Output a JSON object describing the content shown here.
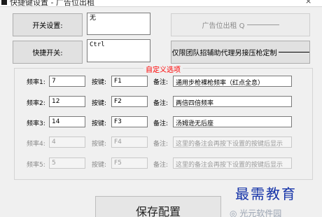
{
  "window": {
    "title": "快捷键设置 - 广告位出租",
    "close_symbol": "×"
  },
  "top": {
    "switch_button": "开关设置:",
    "switch_value": "无",
    "hotkey_button": "快捷开关:",
    "hotkey_value": "Ctrl",
    "ad_button": "广告位出租 Q",
    "custom_button": "仅限团队招辅助代理另接压枪定制"
  },
  "group_title": "自定义选项",
  "rows": [
    {
      "freq_label": "频率1:",
      "freq": "7",
      "key_label": "按键:",
      "key": "F1",
      "note_label": "备注:",
      "note": "通用步枪裸枪频率（红点全息）",
      "enabled": true
    },
    {
      "freq_label": "频率2:",
      "freq": "12",
      "key_label": "按键:",
      "key": "F2",
      "note_label": "备注:",
      "note": "两倍四倍频率",
      "enabled": true
    },
    {
      "freq_label": "频率3:",
      "freq": "14",
      "key_label": "按键:",
      "key": "F3",
      "note_label": "备注:",
      "note": "汤姆逊无后座",
      "enabled": true
    },
    {
      "freq_label": "频率4:",
      "freq": "4",
      "key_label": "按键:",
      "key": "F4",
      "note_label": "备注:",
      "note": "这里的备注会再按下设置的按键后显示",
      "enabled": false
    },
    {
      "freq_label": "频率5:",
      "freq": "5",
      "key_label": "按键:",
      "key": "F5",
      "note_label": "备注:",
      "note": "这里的备注会再按下设置的按键后显示",
      "enabled": false
    }
  ],
  "save_button": "保存配置",
  "watermark": {
    "main": "最需教育",
    "sub": "◎ 光元软件园"
  }
}
